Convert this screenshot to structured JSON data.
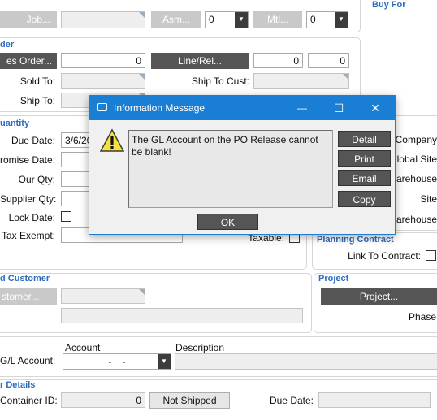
{
  "header_row": {
    "job_button": "Job...",
    "asm_button": "Asm...",
    "asm_value": "0",
    "mtl_button": "Mtl...",
    "mtl_value": "0",
    "buy_for_title": "Buy For"
  },
  "order": {
    "title": "der",
    "sales_order_button": "es Order...",
    "sales_order_value": "0",
    "line_rel_button": "Line/Rel...",
    "line_value": "0",
    "rel_value": "0",
    "sold_to_label": "Sold To:",
    "ship_to_cust_label": "Ship To Cust:",
    "ship_to_label": "Ship To:"
  },
  "quantity": {
    "title": "uantity",
    "due_date_label": "Due Date:",
    "due_date_value": "3/6/20",
    "promise_date_label": "romise Date:",
    "our_qty_label": "Our Qty:",
    "supplier_qty_label": "Supplier Qty:",
    "lock_date_label": "Lock Date:",
    "tax_exempt_label": "Tax Exempt:",
    "taxable_label": "Taxable:"
  },
  "right_labels": {
    "company": "Company",
    "global_site": "lobal Site",
    "warehouse1": "arehouse",
    "site": "Site",
    "warehouse2": "arehouse"
  },
  "planning_contract": {
    "title": "Planning Contract",
    "link_label": "Link To Contract:"
  },
  "customer": {
    "title": "d Customer",
    "customer_button": "stomer..."
  },
  "project": {
    "title": "Project",
    "project_button": "Project...",
    "phase_label": "Phase"
  },
  "gl": {
    "account_header": "Account",
    "description_header": "Description",
    "gl_account_label": "G/L Account:",
    "gl_account_value": "-    -"
  },
  "container": {
    "title": "r Details",
    "container_id_label": "Container ID:",
    "container_id_value": "0",
    "status_button": "Not Shipped",
    "due_date_label": "Due Date:"
  },
  "dialog": {
    "title": "Information Message",
    "message": "The GL Account on the PO Release cannot be blank!",
    "detail_button": "Detail",
    "print_button": "Print",
    "email_button": "Email",
    "copy_button": "Copy",
    "ok_button": "OK",
    "minimize_symbol": "—",
    "maximize_symbol": "☐",
    "close_symbol": "✕",
    "warning_symbol": "!"
  },
  "colors": {
    "accent": "#1a7fd4",
    "section_title": "#2c6bbf",
    "button_dark": "#555555",
    "button_disabled": "#c9c9c9"
  }
}
